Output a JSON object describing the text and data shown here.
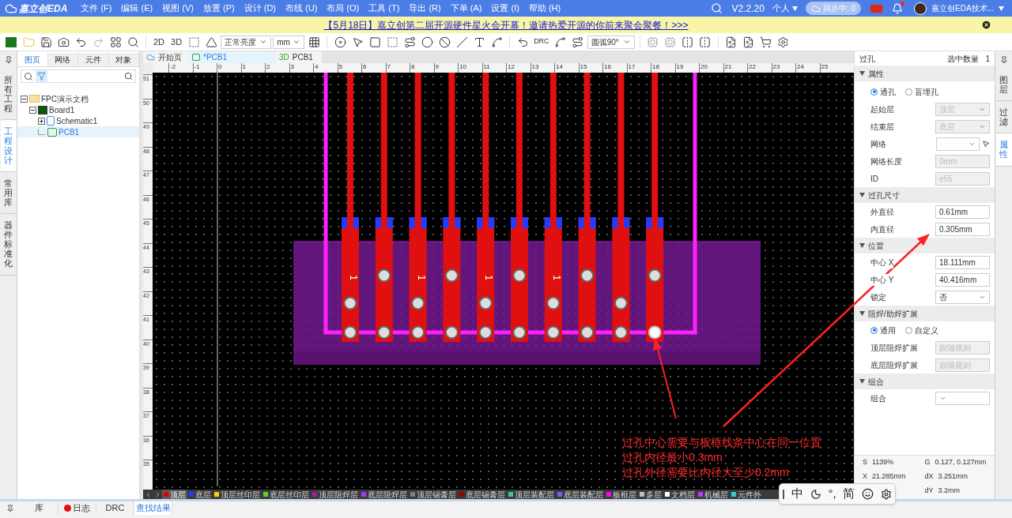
{
  "app": {
    "logo": "嘉立创EDA",
    "menus": [
      "文件 (F)",
      "编辑 (E)",
      "视图 (V)",
      "放置 (P)",
      "设计 (D)",
      "布线 (U)",
      "布局 (O)",
      "工具 (T)",
      "导出 (R)",
      "下单 (A)",
      "设置 (I)",
      "帮助 (H)"
    ],
    "version": "V2.2.20",
    "account": "个人",
    "sync": "同步中: 0",
    "user": "嘉立创EDA技术..."
  },
  "banner": {
    "text": "【5月18日】嘉立创第二届开源硬件星火会开幕！邀请热爱开源的你前来聚会聚餐！>>>"
  },
  "toolbar": {
    "view_buttons": [
      "2D",
      "3D"
    ],
    "brightness": "正常亮度",
    "unit": "mm",
    "drc": "DRC",
    "arc_mode": "圆弧90°"
  },
  "left_tabs": [
    {
      "label": "所有工程",
      "selected": false
    },
    {
      "label": "工程设计",
      "selected": true
    },
    {
      "label": "常用库",
      "selected": false
    },
    {
      "label": "器件标准化",
      "selected": false
    }
  ],
  "panel_tabs": [
    {
      "label": "图页",
      "selected": true
    },
    {
      "label": "网络",
      "selected": false
    },
    {
      "label": "元件",
      "selected": false
    },
    {
      "label": "对象",
      "selected": false
    }
  ],
  "tree": [
    {
      "label": "FPC演示文档",
      "kind": "folder",
      "expanded": true,
      "selected": false,
      "children": [
        {
          "label": "Board1",
          "kind": "board",
          "expanded": true,
          "selected": false,
          "children": [
            {
              "label": "Schematic1",
              "kind": "schematic",
              "expanded": false,
              "selected": false
            },
            {
              "label": "PCB1",
              "kind": "pcb",
              "selected": true
            }
          ]
        }
      ]
    }
  ],
  "doc_tabs": [
    {
      "label": "开始页",
      "kind": "home",
      "selected": false
    },
    {
      "label": "*PCB1",
      "kind": "pcb",
      "selected": true
    },
    {
      "label": "PCB1",
      "kind": "model",
      "badge": "3D",
      "selected": false
    }
  ],
  "top_ruler": [
    "-2",
    "-1",
    "0",
    "1",
    "2",
    "3",
    "4",
    "5",
    "6",
    "7",
    "8",
    "9",
    "10",
    "11",
    "12",
    "13",
    "14",
    "15",
    "16",
    "17",
    "18",
    "19",
    "20",
    "21",
    "22",
    "23",
    "24",
    "25"
  ],
  "left_ruler": [
    "51",
    "50",
    "49",
    "48",
    "47",
    "46",
    "45",
    "44",
    "43",
    "42",
    "41",
    "40",
    "39",
    "38",
    "37",
    "36",
    "35"
  ],
  "pads": [
    {
      "label": "1",
      "selected": false
    },
    {
      "selected": false
    },
    {
      "label": "1",
      "selected": false
    },
    {
      "selected": false
    },
    {
      "label": "1",
      "selected": false
    },
    {
      "selected": false
    },
    {
      "label": "1",
      "selected": false
    },
    {
      "selected": false
    },
    {
      "selected": false
    },
    {
      "selected": true
    }
  ],
  "annotation": [
    "过孔中心需要与板框线条中心在同一位置",
    "过孔内径最小0.3mm",
    "过孔外径需要比内径大至少0.2mm"
  ],
  "layers": [
    {
      "label": "顶层",
      "color": "#e00000",
      "selected": true
    },
    {
      "label": "底层",
      "color": "#1f3cff",
      "selected": false
    },
    {
      "label": "顶层丝印层",
      "color": "#ffcc00",
      "selected": false
    },
    {
      "label": "底层丝印层",
      "color": "#66cc33",
      "selected": false
    },
    {
      "label": "顶层阻焊层",
      "color": "#a0209f",
      "selected": false
    },
    {
      "label": "底层阻焊层",
      "color": "#aa33ff",
      "selected": false
    },
    {
      "label": "顶层锡膏层",
      "color": "#808080",
      "selected": false
    },
    {
      "label": "底层锡膏层",
      "color": "#990000",
      "selected": false
    },
    {
      "label": "顶层装配层",
      "color": "#33cc99",
      "selected": false
    },
    {
      "label": "底层装配层",
      "color": "#6666ff",
      "selected": false
    },
    {
      "label": "板框层",
      "color": "#ff00ff",
      "selected": false
    },
    {
      "label": "多层",
      "color": "#c0c0c0",
      "selected": false
    },
    {
      "label": "文档层",
      "color": "#ffffff",
      "selected": false
    },
    {
      "label": "机械层",
      "color": "#cc33ff",
      "selected": false
    },
    {
      "label": "元件外",
      "color": "#33cccc",
      "selected": false
    }
  ],
  "properties": {
    "title": "过孔",
    "count_label": "选中数量",
    "count": "1",
    "sections": [
      {
        "title": "属性",
        "expanded": true,
        "rows": [
          {
            "kind": "radio",
            "options": [
              {
                "label": "通孔",
                "selected": true
              },
              {
                "label": "盲埋孔",
                "selected": false
              }
            ]
          },
          {
            "kind": "select",
            "label": "起始层",
            "value": "顶层",
            "disabled": true
          },
          {
            "kind": "select",
            "label": "结束层",
            "value": "底层",
            "disabled": true
          },
          {
            "kind": "select_action",
            "label": "网络",
            "disabled": false
          },
          {
            "kind": "input",
            "label": "网络长度",
            "value": "0mm",
            "disabled": true
          },
          {
            "kind": "input",
            "label": "ID",
            "value": "e55",
            "disabled": true
          }
        ]
      },
      {
        "title": "过孔尺寸",
        "expanded": true,
        "rows": [
          {
            "kind": "input",
            "label": "外直径",
            "value": "0.61mm",
            "disabled": false
          },
          {
            "kind": "input",
            "label": "内直径",
            "value": "0.305mm",
            "disabled": false
          }
        ]
      },
      {
        "title": "位置",
        "expanded": true,
        "rows": [
          {
            "kind": "input",
            "label": "中心 X",
            "value": "18.111mm",
            "disabled": false
          },
          {
            "kind": "input",
            "label": "中心 Y",
            "value": "40.416mm",
            "disabled": false
          },
          {
            "kind": "select",
            "label": "锁定",
            "value": "否",
            "disabled": false
          }
        ]
      },
      {
        "title": "阻焊/助焊扩展",
        "expanded": true,
        "rows": [
          {
            "kind": "radio",
            "options": [
              {
                "label": "通用",
                "selected": true
              },
              {
                "label": "自定义",
                "selected": false
              }
            ]
          },
          {
            "kind": "input",
            "label": "顶层阻焊扩展",
            "value": "跟随规则",
            "disabled": true
          },
          {
            "kind": "input",
            "label": "底层阻焊扩展",
            "value": "跟随规则",
            "disabled": true
          }
        ]
      },
      {
        "title": "组合",
        "expanded": true,
        "rows": [
          {
            "kind": "select",
            "label": "组合",
            "disabled": false
          }
        ]
      }
    ]
  },
  "right_tabs": [
    {
      "label": "图层",
      "selected": false
    },
    {
      "label": "过滤",
      "selected": false
    },
    {
      "label": "属性",
      "selected": true
    }
  ],
  "status": [
    {
      "label": "S",
      "value": "1139%"
    },
    {
      "label": "G",
      "value": "0.127, 0.127mm"
    },
    {
      "label": "X",
      "value": "21.285mm"
    },
    {
      "label": "dX",
      "value": "3.251mm"
    },
    {
      "label": "dY",
      "value": "3.2mm"
    }
  ],
  "bottom_tabs": [
    {
      "label": "库",
      "selected": false,
      "dot": false
    },
    {
      "label": "日志",
      "selected": false,
      "dot": true
    },
    {
      "label": "DRC",
      "selected": false,
      "dot": false
    },
    {
      "label": "查找结果",
      "selected": true,
      "dot": false
    }
  ],
  "ime": {
    "mode": "中",
    "punct": "°,",
    "script": "简"
  }
}
